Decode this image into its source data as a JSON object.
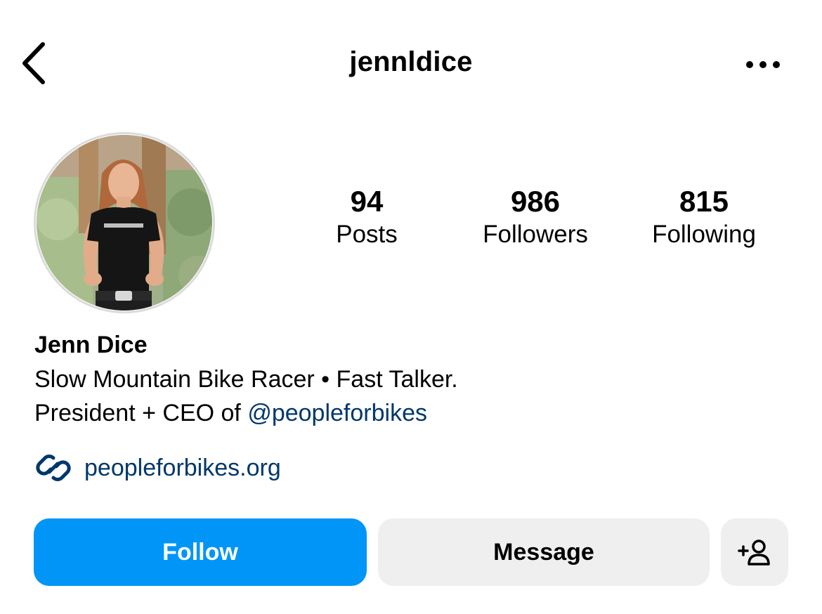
{
  "header": {
    "username": "jennldice",
    "back_icon": "chevron-left-icon",
    "more_icon": "more-horizontal-icon"
  },
  "profile": {
    "avatar_icon": "profile-photo",
    "stats": {
      "posts": {
        "value": "94",
        "label": "Posts"
      },
      "followers": {
        "value": "986",
        "label": "Followers"
      },
      "following": {
        "value": "815",
        "label": "Following"
      }
    },
    "name": "Jenn Dice",
    "bio_line1": "Slow Mountain Bike Racer • Fast Talker.",
    "bio_line2_prefix": "President + CEO of ",
    "bio_mention": "@peopleforbikes",
    "link_icon": "link-icon",
    "link_text": "peopleforbikes.org"
  },
  "actions": {
    "follow_label": "Follow",
    "message_label": "Message",
    "add_user_icon": "add-person-icon"
  },
  "colors": {
    "follow_button": "#0095f6",
    "secondary_button": "#efefef",
    "link": "#00376b"
  }
}
